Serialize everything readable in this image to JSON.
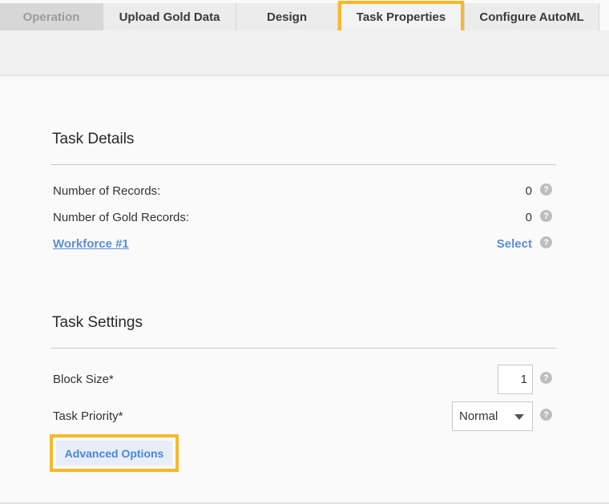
{
  "tabs": [
    {
      "label": "Operation",
      "state": "disabled"
    },
    {
      "label": "Upload Gold Data",
      "state": "normal"
    },
    {
      "label": "Design",
      "state": "normal"
    },
    {
      "label": "Task Properties",
      "state": "active"
    },
    {
      "label": "Configure AutoML",
      "state": "normal"
    }
  ],
  "task_details": {
    "title": "Task Details",
    "records_label": "Number of Records:",
    "records_value": "0",
    "gold_records_label": "Number of Gold Records:",
    "gold_records_value": "0",
    "workforce_link": "Workforce #1",
    "workforce_select": "Select"
  },
  "task_settings": {
    "title": "Task Settings",
    "block_size_label": "Block Size*",
    "block_size_value": "1",
    "priority_label": "Task Priority*",
    "priority_selected": "Normal",
    "advanced_button": "Advanced Options"
  },
  "help_glyph": "?",
  "colors": {
    "highlight": "#f9b72b",
    "link": "#5b8fd6",
    "button_bg": "#e7eef9"
  }
}
